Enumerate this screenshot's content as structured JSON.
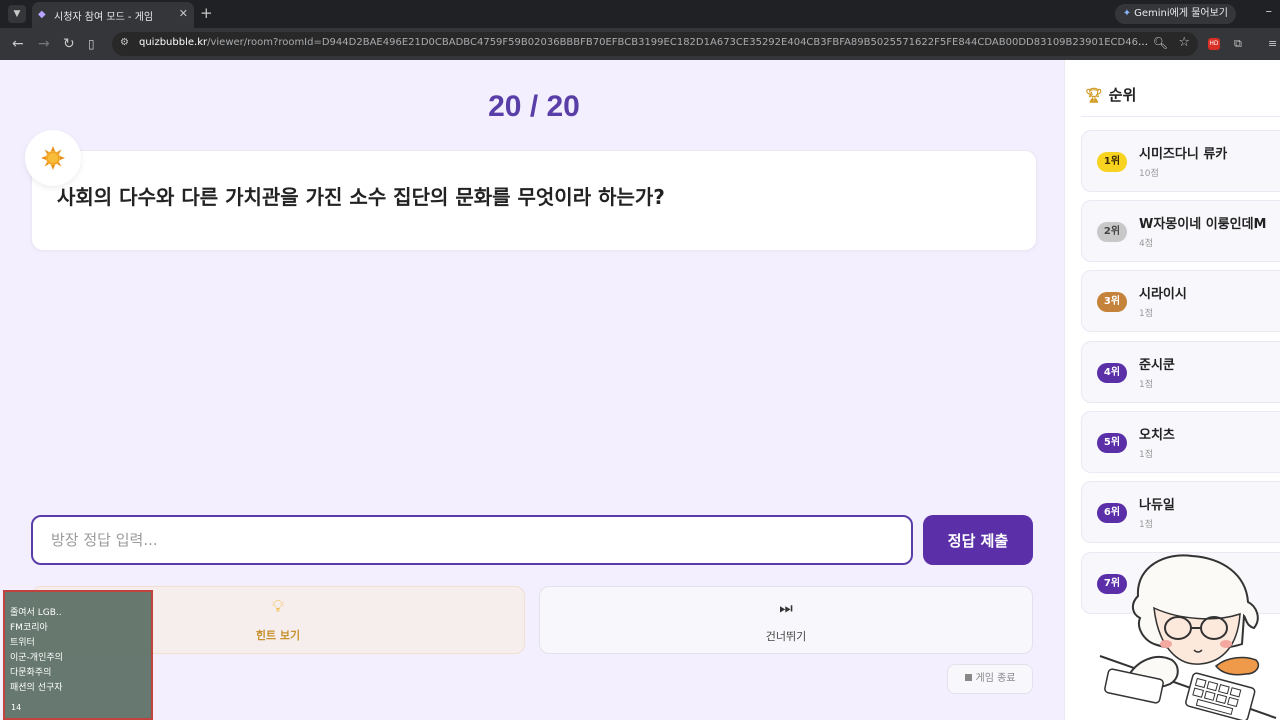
{
  "browser": {
    "tab_title": "시청자 참여 모드 - 게임",
    "gemini_label": "Gemini에게 물어보기",
    "url_host": "quizbubble.kr",
    "url_path": "/viewer/room?roomId=D944D2BAE496E21D0CBADBC4759F59B02036BBBFB70EFBCB3199EC182D1A673CE35292E404CB3FBFA89B5025571622F5FE844CDAB00DD83109B23901ECD46808F28F4F084D90B06F3C185..."
  },
  "game": {
    "counter": "20 / 20",
    "question": "사회의 다수와 다른 가치관을 가진 소수 집단의 문화를 무엇이라 하는가?",
    "answer_placeholder": "방장 정답 입력...",
    "submit_label": "정답 제출",
    "hint_label": "힌트 보기",
    "skip_label": "건너뛰기",
    "end_label": "게임 종료"
  },
  "ranking": {
    "title": "순위",
    "items": [
      {
        "rank": "1위",
        "name": "시미즈다니 류카",
        "score": "10점"
      },
      {
        "rank": "2위",
        "name": "W자몽이네 이룽인데M",
        "score": "4점"
      },
      {
        "rank": "3위",
        "name": "시라이시",
        "score": "1점"
      },
      {
        "rank": "4위",
        "name": "준시쿤",
        "score": "1점"
      },
      {
        "rank": "5위",
        "name": "오치츠",
        "score": "1점"
      },
      {
        "rank": "6위",
        "name": "나듀일",
        "score": "1점"
      },
      {
        "rank": "7위",
        "name": "",
        "score": ""
      }
    ]
  },
  "chat_overlay": {
    "lines": [
      "줄여서 LGB..",
      "FM코리아",
      "트위터",
      "이군-개인주의",
      "다문화주의",
      "패션의 선구자"
    ],
    "footer": "14"
  },
  "colors": {
    "accent": "#5b2fa8",
    "rank1": "#f7d21f",
    "rank2": "#c8c8c8",
    "rank3": "#c5823b",
    "rank_other": "#5b2fa8"
  }
}
